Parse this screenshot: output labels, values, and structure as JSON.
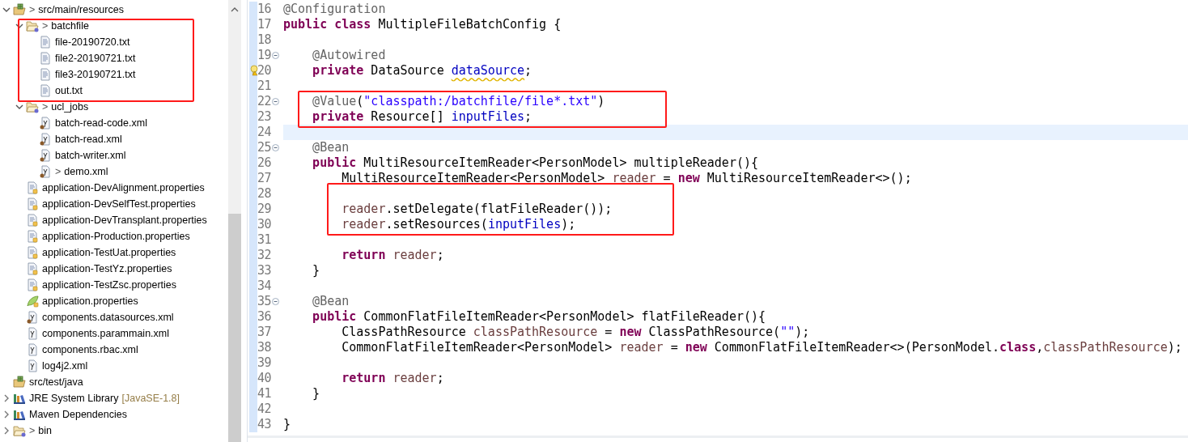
{
  "project_tree": {
    "items": [
      {
        "label": "src/main/resources",
        "decoration": ">",
        "kind": "source-folder",
        "expanded": true,
        "children": [
          {
            "label": "batchfile",
            "decoration": ">",
            "kind": "folder",
            "expanded": true,
            "boxed": true,
            "children": [
              {
                "label": "file-20190720.txt",
                "kind": "text-file"
              },
              {
                "label": "file2-20190721.txt",
                "kind": "text-file"
              },
              {
                "label": "file3-20190721.txt",
                "kind": "text-file"
              },
              {
                "label": "out.txt",
                "kind": "text-file"
              }
            ]
          },
          {
            "label": "ucl_jobs",
            "decoration": ">",
            "kind": "folder",
            "expanded": true,
            "children": [
              {
                "label": "batch-read-code.xml",
                "kind": "spring-xml"
              },
              {
                "label": "batch-read.xml",
                "kind": "spring-xml"
              },
              {
                "label": "batch-writer.xml",
                "kind": "spring-xml"
              },
              {
                "label": "demo.xml",
                "decoration": ">",
                "kind": "spring-xml"
              }
            ]
          },
          {
            "label": "application-DevAlignment.properties",
            "kind": "properties-file"
          },
          {
            "label": "application-DevSelfTest.properties",
            "kind": "properties-file"
          },
          {
            "label": "application-DevTransplant.properties",
            "kind": "properties-file"
          },
          {
            "label": "application-Production.properties",
            "kind": "properties-file"
          },
          {
            "label": "application-TestUat.properties",
            "kind": "properties-file"
          },
          {
            "label": "application-TestYz.properties",
            "kind": "properties-file"
          },
          {
            "label": "application-TestZsc.properties",
            "kind": "properties-file"
          },
          {
            "label": "application.properties",
            "kind": "spring-properties"
          },
          {
            "label": "components.datasources.xml",
            "kind": "spring-xml"
          },
          {
            "label": "components.parammain.xml",
            "kind": "xml-file"
          },
          {
            "label": "components.rbac.xml",
            "kind": "xml-file"
          },
          {
            "label": "log4j2.xml",
            "kind": "xml-file"
          }
        ]
      },
      {
        "label": "src/test/java",
        "kind": "source-folder"
      },
      {
        "label": "JRE System Library",
        "suffix": "[JavaSE-1.8]",
        "kind": "library",
        "expanded": false
      },
      {
        "label": "Maven Dependencies",
        "kind": "library",
        "expanded": false
      },
      {
        "label": "bin",
        "decoration": ">",
        "kind": "folder",
        "expanded": false
      }
    ]
  },
  "editor": {
    "lines": [
      {
        "number": "16",
        "tokens": [
          {
            "kind": "annotation",
            "text": "@Configuration"
          }
        ]
      },
      {
        "number": "17",
        "tokens": [
          {
            "kind": "keyword",
            "text": "public"
          },
          {
            "kind": "keyword",
            "text": " class"
          },
          {
            "kind": "plain",
            "text": " MultipleFileBatchConfig {"
          }
        ]
      },
      {
        "number": "18"
      },
      {
        "number": "19",
        "fold": true,
        "tokens": [
          {
            "kind": "annotation",
            "text": "    @Autowired"
          }
        ]
      },
      {
        "number": "20",
        "warning": true,
        "tokens": [
          {
            "kind": "keyword",
            "text": "    private"
          },
          {
            "kind": "plain",
            "text": " DataSource "
          },
          {
            "kind": "field-warning",
            "text": "dataSource"
          },
          {
            "kind": "plain",
            "text": ";"
          }
        ]
      },
      {
        "number": "21"
      },
      {
        "number": "22",
        "fold": true,
        "boxed": true,
        "tokens": [
          {
            "kind": "annotation",
            "text": "    @Value"
          },
          {
            "kind": "plain",
            "text": "("
          },
          {
            "kind": "string",
            "text": "\"classpath:/batchfile/file*.txt\""
          },
          {
            "kind": "plain",
            "text": ")"
          }
        ]
      },
      {
        "number": "23",
        "boxed": true,
        "tokens": [
          {
            "kind": "keyword",
            "text": "    private"
          },
          {
            "kind": "plain",
            "text": " Resource[] "
          },
          {
            "kind": "field",
            "text": "inputFiles"
          },
          {
            "kind": "plain",
            "text": ";"
          }
        ]
      },
      {
        "number": "24",
        "current": true
      },
      {
        "number": "25",
        "fold": true,
        "tokens": [
          {
            "kind": "annotation",
            "text": "    @Bean"
          }
        ]
      },
      {
        "number": "26",
        "tokens": [
          {
            "kind": "keyword",
            "text": "    public"
          },
          {
            "kind": "plain",
            "text": " MultiResourceItemReader<PersonModel> multipleReader(){"
          }
        ]
      },
      {
        "number": "27",
        "tokens": [
          {
            "kind": "plain",
            "text": "        MultiResourceItemReader<PersonModel> "
          },
          {
            "kind": "local",
            "text": "reader"
          },
          {
            "kind": "plain",
            "text": " = "
          },
          {
            "kind": "keyword",
            "text": "new"
          },
          {
            "kind": "plain",
            "text": " MultiResourceItemReader<>();"
          }
        ]
      },
      {
        "number": "28",
        "boxed": true
      },
      {
        "number": "29",
        "boxed": true,
        "tokens": [
          {
            "kind": "local",
            "text": "        reader"
          },
          {
            "kind": "plain",
            "text": ".setDelegate(flatFileReader());"
          }
        ]
      },
      {
        "number": "30",
        "boxed": true,
        "tokens": [
          {
            "kind": "local",
            "text": "        reader"
          },
          {
            "kind": "plain",
            "text": ".setResources("
          },
          {
            "kind": "field",
            "text": "inputFiles"
          },
          {
            "kind": "plain",
            "text": ");"
          }
        ]
      },
      {
        "number": "31"
      },
      {
        "number": "32",
        "tokens": [
          {
            "kind": "keyword",
            "text": "        return"
          },
          {
            "kind": "local",
            "text": " reader"
          },
          {
            "kind": "plain",
            "text": ";"
          }
        ]
      },
      {
        "number": "33",
        "tokens": [
          {
            "kind": "plain",
            "text": "    }"
          }
        ]
      },
      {
        "number": "34"
      },
      {
        "number": "35",
        "fold": true,
        "tokens": [
          {
            "kind": "annotation",
            "text": "    @Bean"
          }
        ]
      },
      {
        "number": "36",
        "tokens": [
          {
            "kind": "keyword",
            "text": "    public"
          },
          {
            "kind": "plain",
            "text": " CommonFlatFileItemReader<PersonModel> flatFileReader(){"
          }
        ]
      },
      {
        "number": "37",
        "tokens": [
          {
            "kind": "plain",
            "text": "        ClassPathResource "
          },
          {
            "kind": "local",
            "text": "classPathResource"
          },
          {
            "kind": "plain",
            "text": " = "
          },
          {
            "kind": "keyword",
            "text": "new"
          },
          {
            "kind": "plain",
            "text": " ClassPathResource("
          },
          {
            "kind": "string",
            "text": "\"\""
          },
          {
            "kind": "plain",
            "text": ");"
          }
        ]
      },
      {
        "number": "38",
        "tokens": [
          {
            "kind": "plain",
            "text": "        CommonFlatFileItemReader<PersonModel> "
          },
          {
            "kind": "local",
            "text": "reader"
          },
          {
            "kind": "plain",
            "text": " = "
          },
          {
            "kind": "keyword",
            "text": "new"
          },
          {
            "kind": "plain",
            "text": " CommonFlatFileItemReader<>(PersonModel."
          },
          {
            "kind": "keyword",
            "text": "class"
          },
          {
            "kind": "plain",
            "text": ","
          },
          {
            "kind": "local",
            "text": "classPathResource"
          },
          {
            "kind": "plain",
            "text": ");"
          }
        ]
      },
      {
        "number": "39"
      },
      {
        "number": "40",
        "tokens": [
          {
            "kind": "keyword",
            "text": "        return"
          },
          {
            "kind": "local",
            "text": " reader"
          },
          {
            "kind": "plain",
            "text": ";"
          }
        ]
      },
      {
        "number": "41",
        "tokens": [
          {
            "kind": "plain",
            "text": "    }"
          }
        ]
      },
      {
        "number": "42"
      },
      {
        "number": "43",
        "tokens": [
          {
            "kind": "plain",
            "text": "}"
          }
        ]
      }
    ]
  }
}
